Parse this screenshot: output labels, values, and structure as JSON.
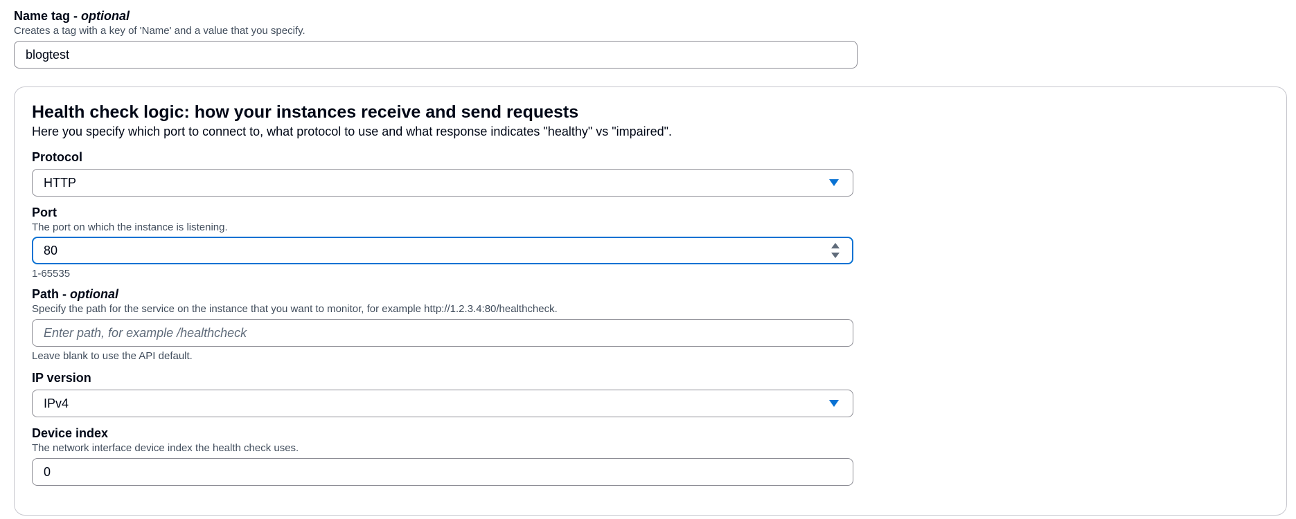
{
  "name_tag": {
    "label": "Name tag - ",
    "optional": "optional",
    "description": "Creates a tag with a key of 'Name' and a value that you specify.",
    "value": "blogtest"
  },
  "health_check": {
    "title": "Health check logic: how your instances receive and send requests",
    "description": "Here you specify which port to connect to, what protocol to use and what response indicates \"healthy\" vs \"impaired\".",
    "protocol": {
      "label": "Protocol",
      "value": "HTTP"
    },
    "port": {
      "label": "Port",
      "description": "The port on which the instance is listening.",
      "value": "80",
      "hint": "1-65535"
    },
    "path": {
      "label": "Path - ",
      "optional": "optional",
      "description": "Specify the path for the service on the instance that you want to monitor, for example http://1.2.3.4:80/healthcheck.",
      "placeholder": "Enter path, for example /healthcheck",
      "hint": "Leave blank to use the API default."
    },
    "ip_version": {
      "label": "IP version",
      "value": "IPv4"
    },
    "device_index": {
      "label": "Device index",
      "description": "The network interface device index the health check uses.",
      "value": "0"
    }
  },
  "icons": {
    "select_caret": "caret-down-icon",
    "number_stepper": "stepper-icon"
  },
  "colors": {
    "accent": "#0972d3",
    "border": "#8c8c94",
    "text": "#000716",
    "secondary_text": "#414d5c",
    "container_border": "#c6c6cd"
  }
}
